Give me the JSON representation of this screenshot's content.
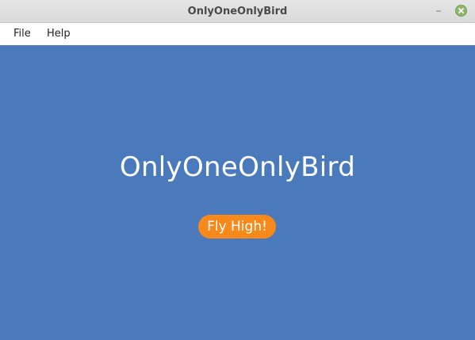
{
  "window": {
    "title": "OnlyOneOnlyBird",
    "minimize_glyph": "–",
    "close_icon": "close-icon"
  },
  "menubar": {
    "items": [
      {
        "label": "File"
      },
      {
        "label": "Help"
      }
    ]
  },
  "main": {
    "title": "OnlyOneOnlyBird",
    "button_label": "Fly High!"
  },
  "colors": {
    "background": "#4a7abb",
    "button": "#f7891a",
    "close": "#8fb56a"
  }
}
